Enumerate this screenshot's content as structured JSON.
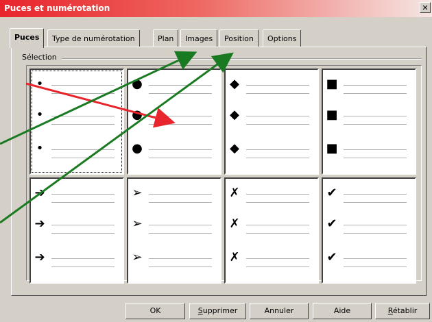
{
  "window": {
    "title": "Puces et numérotation",
    "close_label": "✕"
  },
  "tabs": [
    {
      "label": "Puces",
      "active": true
    },
    {
      "label": "Type de numérotation",
      "active": false
    },
    {
      "label": "Plan",
      "active": false
    },
    {
      "label": "Images",
      "active": false
    },
    {
      "label": "Position",
      "active": false
    },
    {
      "label": "Options",
      "active": false
    }
  ],
  "selection": {
    "label": "Sélection",
    "cells": [
      {
        "symbol": "•",
        "icon": "small-dot-icon",
        "selected": true
      },
      {
        "symbol": "●",
        "icon": "large-dot-icon",
        "selected": false
      },
      {
        "symbol": "◆",
        "icon": "diamond-icon",
        "selected": false
      },
      {
        "symbol": "■",
        "icon": "square-icon",
        "selected": false
      },
      {
        "symbol": "➔",
        "icon": "arrow-icon",
        "selected": false
      },
      {
        "symbol": "➢",
        "icon": "arrowhead-icon",
        "selected": false
      },
      {
        "symbol": "✗",
        "icon": "cross-icon",
        "selected": false
      },
      {
        "symbol": "✔",
        "icon": "check-icon",
        "selected": false
      }
    ]
  },
  "buttons": {
    "ok": "OK",
    "supprimer_u": "S",
    "supprimer_rest": "upprimer",
    "annuler": "Annuler",
    "aide": "Aide",
    "retablir_u": "R",
    "retablir_rest": "établir"
  },
  "colors": {
    "title_start": "#e8242c",
    "annotation_red": "#e8242c",
    "annotation_green": "#1a7a22",
    "background_cyan": "#00e6f0",
    "background_magenta": "#e80080"
  }
}
